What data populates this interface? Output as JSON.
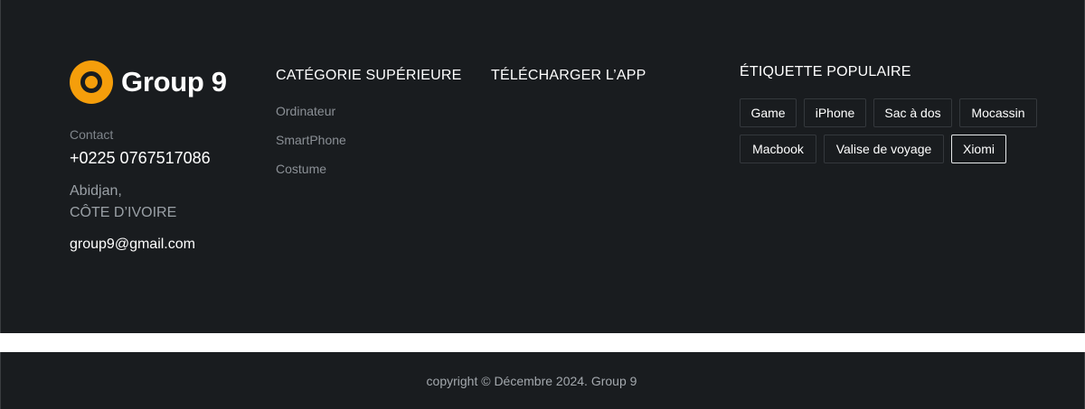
{
  "brand": {
    "name": "Group 9",
    "logo_icon": "circle-ring-logo",
    "accent_color": "#f59e0b"
  },
  "contact": {
    "label": "Contact",
    "phone": "+0225 0767517086",
    "city": "Abidjan,",
    "country": "CÔTE D’IVOIRE",
    "email": "group9@gmail.com"
  },
  "categories": {
    "title": "CATÉGORIE SUPÉRIEURE",
    "items": [
      "Ordinateur",
      "SmartPhone",
      "Costume"
    ]
  },
  "download": {
    "title": "TÉLÉCHARGER L’APP"
  },
  "tags": {
    "title": "ÉTIQUETTE POPULAIRE",
    "items": [
      "Game",
      "iPhone",
      "Sac à dos",
      "Mocassin",
      "Macbook",
      "Valise de voyage",
      "Xiomi"
    ],
    "active": "Xiomi"
  },
  "footer": {
    "copyright": "copyright © Décembre 2024. Group 9"
  }
}
